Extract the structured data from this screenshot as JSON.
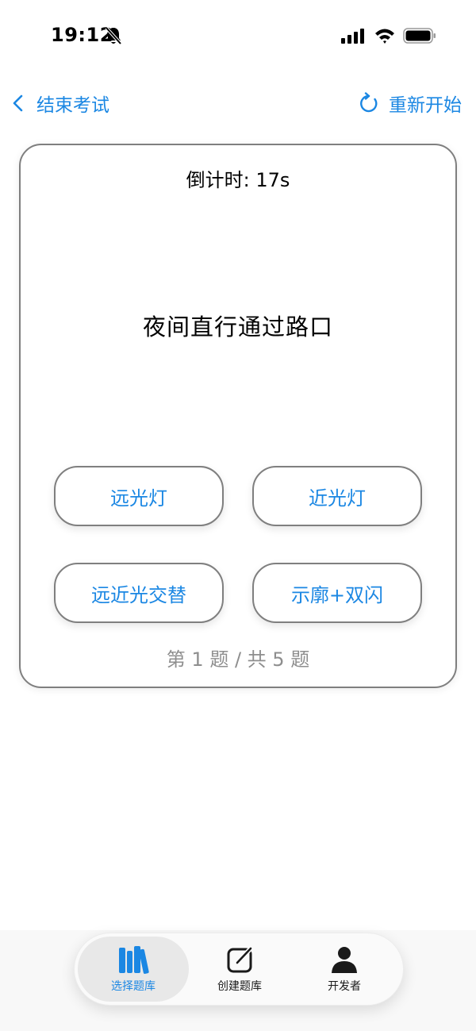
{
  "status_bar": {
    "time": "19:12",
    "icons": [
      "bell-slash-icon",
      "cellular-signal-icon",
      "wifi-icon",
      "battery-icon"
    ]
  },
  "nav": {
    "back_label": "结束考试",
    "restart_label": "重新开始"
  },
  "quiz": {
    "countdown_label": "倒计时:",
    "countdown_value": "17s",
    "question": "夜间直行通过路口",
    "options": [
      "远光灯",
      "近光灯",
      "远近光交替",
      "示廓+双闪"
    ],
    "progress": "第 1 题 / 共 5 题",
    "current_question": 1,
    "total_questions": 5
  },
  "tab_bar": {
    "selected_index": 0,
    "tabs": [
      {
        "label": "选择题库",
        "icon": "books-icon"
      },
      {
        "label": "创建题库",
        "icon": "square-pencil-icon"
      },
      {
        "label": "开发者",
        "icon": "person-icon"
      }
    ]
  },
  "colors": {
    "accent": "#1b87e3",
    "border": "#7f7f7f",
    "muted_text": "#8e8e8e"
  }
}
